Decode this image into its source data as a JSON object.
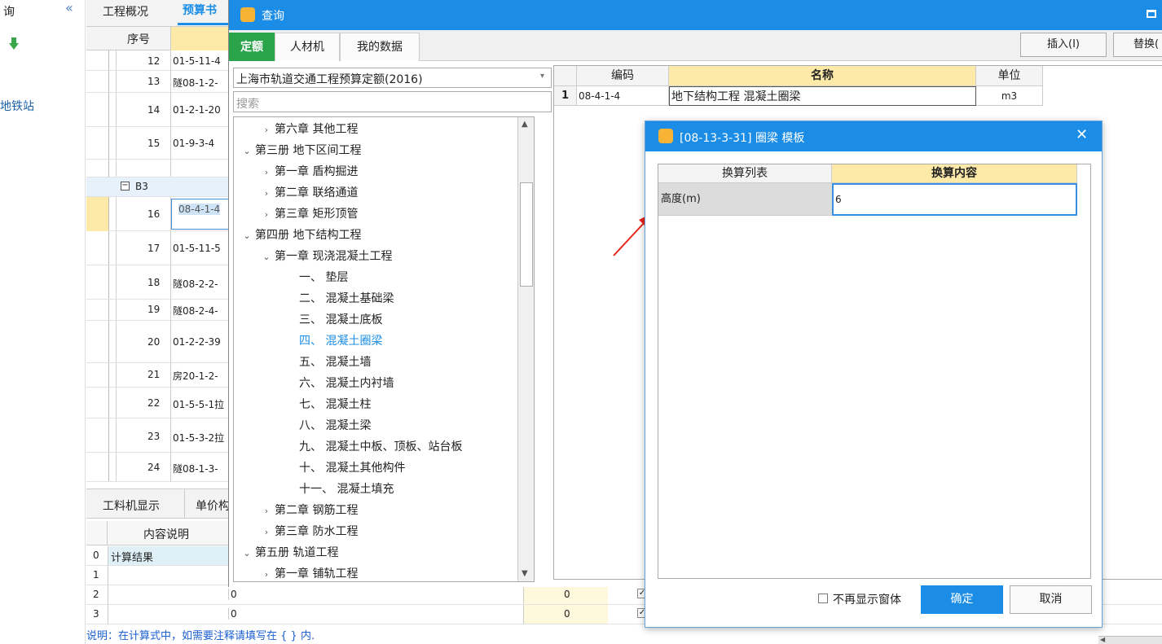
{
  "left_panel": {
    "top_label": "询",
    "collapse_glyph": "«",
    "station_label": "地铁站"
  },
  "bg_tabs": {
    "overview": "工程概况",
    "budget": "预算书"
  },
  "grid": {
    "seq_header": "序号",
    "rows": [
      {
        "num": "12",
        "code": "01-5-11-4"
      },
      {
        "num": "13",
        "code": "隧08-1-2-"
      },
      {
        "num": "14",
        "code": "01-2-1-20"
      },
      {
        "num": "15",
        "code": "01-9-3-4"
      },
      {
        "num": "",
        "code": ""
      },
      {
        "num": "B3",
        "code": ""
      },
      {
        "num": "16",
        "code": "08-4-1-4"
      },
      {
        "num": "17",
        "code": "01-5-11-5"
      },
      {
        "num": "18",
        "code": "隧08-2-2-"
      },
      {
        "num": "19",
        "code": "隧08-2-4-"
      },
      {
        "num": "20",
        "code": "01-2-2-39"
      },
      {
        "num": "21",
        "code": "房20-1-2-"
      },
      {
        "num": "22",
        "code": "01-5-5-1拉"
      },
      {
        "num": "23",
        "code": "01-5-3-2拉"
      },
      {
        "num": "24",
        "code": "隧08-1-3-"
      }
    ]
  },
  "bottom_tabs": {
    "labor": "工料机显示",
    "unit_price": "单价构"
  },
  "bottom_grid": {
    "content_header": "内容说明",
    "rows": [
      {
        "idx": "0",
        "text": "计算结果",
        "v1": "",
        "v2": ""
      },
      {
        "idx": "1",
        "text": "",
        "v1": "",
        "v2": ""
      },
      {
        "idx": "2",
        "text": "",
        "v1": "0",
        "v2": "0"
      },
      {
        "idx": "3",
        "text": "",
        "v1": "0",
        "v2": "0"
      }
    ],
    "note": "说明：在计算式中，如需要注释请填写在 { } 内."
  },
  "query_window": {
    "title": "查询",
    "tabs": [
      "定额",
      "人材机",
      "我的数据"
    ],
    "insert_btn": "插入(I)",
    "replace_btn": "替换(",
    "quota_select": "上海市轨道交通工程预算定额(2016)",
    "search_placeholder": "搜索",
    "tree": [
      {
        "indent": 1,
        "arrow": "›",
        "text": "第六章 其他工程"
      },
      {
        "indent": 0,
        "arrow": "⌄",
        "text": "第三册 地下区间工程"
      },
      {
        "indent": 1,
        "arrow": "›",
        "text": "第一章 盾构掘进"
      },
      {
        "indent": 1,
        "arrow": "›",
        "text": "第二章 联络通道"
      },
      {
        "indent": 1,
        "arrow": "›",
        "text": "第三章 矩形顶管"
      },
      {
        "indent": 0,
        "arrow": "⌄",
        "text": "第四册 地下结构工程"
      },
      {
        "indent": 1,
        "arrow": "⌄",
        "text": "第一章 现浇混凝土工程"
      },
      {
        "indent": 2,
        "arrow": "",
        "text": "一、 垫层"
      },
      {
        "indent": 2,
        "arrow": "",
        "text": "二、 混凝土基础梁"
      },
      {
        "indent": 2,
        "arrow": "",
        "text": "三、 混凝土底板"
      },
      {
        "indent": 2,
        "arrow": "",
        "text": "四、 混凝土圈梁"
      },
      {
        "indent": 2,
        "arrow": "",
        "text": "五、 混凝土墙"
      },
      {
        "indent": 2,
        "arrow": "",
        "text": "六、 混凝土内衬墙"
      },
      {
        "indent": 2,
        "arrow": "",
        "text": "七、 混凝土柱"
      },
      {
        "indent": 2,
        "arrow": "",
        "text": "八、 混凝土梁"
      },
      {
        "indent": 2,
        "arrow": "",
        "text": "九、 混凝土中板、顶板、站台板"
      },
      {
        "indent": 2,
        "arrow": "",
        "text": "十、 混凝土其他构件"
      },
      {
        "indent": 2,
        "arrow": "",
        "text": "十一、 混凝土填充"
      },
      {
        "indent": 1,
        "arrow": "›",
        "text": "第二章 钢筋工程"
      },
      {
        "indent": 1,
        "arrow": "›",
        "text": "第三章 防水工程"
      },
      {
        "indent": 0,
        "arrow": "⌄",
        "text": "第五册 轨道工程"
      },
      {
        "indent": 1,
        "arrow": "›",
        "text": "第一章 铺轨工程"
      }
    ],
    "result_table": {
      "headers": {
        "code": "编码",
        "name": "名称",
        "unit": "单位"
      },
      "rows": [
        {
          "idx": "1",
          "code": "08-4-1-4",
          "name": "地下结构工程 混凝土圈梁",
          "unit": "m3"
        }
      ]
    }
  },
  "dialog": {
    "title": "[08-13-3-31] 圈梁 模板",
    "col_list": "换算列表",
    "col_content": "换算内容",
    "rows": [
      {
        "label": "高度(m)",
        "value": "6"
      }
    ],
    "no_show": "不再显示窗体",
    "ok": "确定",
    "cancel": "取消"
  }
}
